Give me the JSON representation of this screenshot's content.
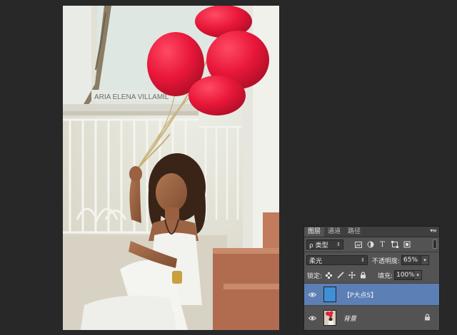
{
  "layers_panel": {
    "tabs": [
      {
        "label": "图层",
        "active": true
      },
      {
        "label": "通道",
        "active": false
      },
      {
        "label": "路径",
        "active": false
      }
    ],
    "filter_label": "ρ 类型",
    "blend_mode": "柔光",
    "opacity_label": "不透明度:",
    "opacity_value": "65%",
    "lock_label": "锁定:",
    "fill_label": "填充:",
    "fill_value": "100%",
    "layers": [
      {
        "name": "【P大点S】",
        "selected": true,
        "thumb_color": "#3f8fd6",
        "visible": true
      },
      {
        "name": "背景",
        "selected": false,
        "locked": true,
        "visible": true
      }
    ]
  },
  "canvas": {
    "sign_text": "ARIA  ELENA  VILLAMIL"
  },
  "colors": {
    "workspace": "#282828",
    "panel": "#535353",
    "selection": "#5c7fb6",
    "balloon_red": "#ea1b3b"
  }
}
